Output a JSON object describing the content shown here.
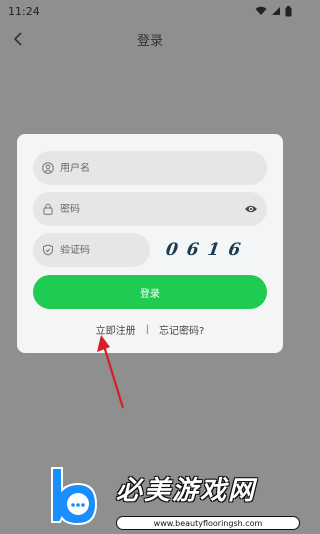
{
  "status": {
    "time": "11:24"
  },
  "header": {
    "title": "登录"
  },
  "form": {
    "username_placeholder": "用户名",
    "password_placeholder": "密码",
    "captcha_placeholder": "验证码",
    "captcha_code": "0616",
    "login_label": "登录",
    "register_label": "立即注册",
    "separator": "|",
    "forgot_label": "忘记密码?"
  },
  "watermark": {
    "title": "必美游戏网",
    "url": "www.beautyflooringsh.com"
  },
  "colors": {
    "background": "#8f8f8f",
    "card": "#f5f5f5",
    "field": "#e6e6e6",
    "accent": "#1fcb50",
    "arrow": "#d61f26",
    "watermark_logo": "#1a8dff"
  },
  "icons": {
    "back": "chevron-left-icon",
    "user": "user-icon",
    "lock": "lock-icon",
    "eye": "eye-icon",
    "shield": "shield-icon",
    "wifi": "wifi-icon",
    "signal": "signal-icon",
    "battery": "battery-icon"
  }
}
